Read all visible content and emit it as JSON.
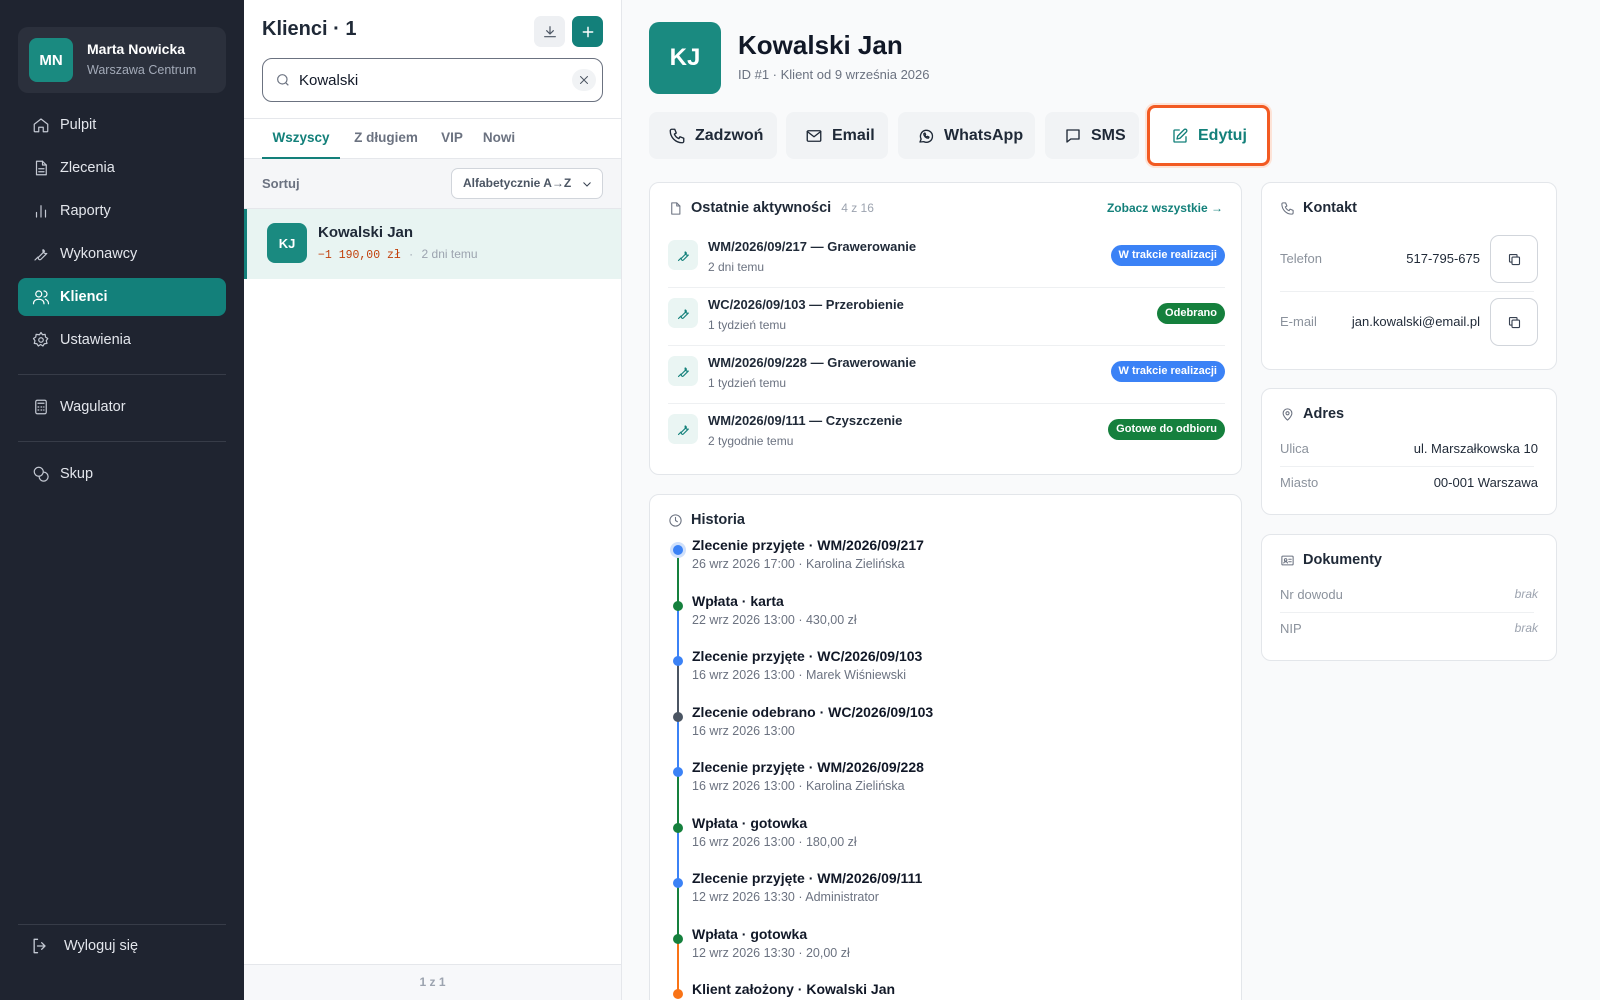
{
  "sidebar": {
    "user": {
      "initials": "MN",
      "name": "Marta Nowicka",
      "location": "Warszawa Centrum"
    },
    "nav": [
      {
        "label": "Pulpit",
        "icon": "home-icon"
      },
      {
        "label": "Zlecenia",
        "icon": "document-icon"
      },
      {
        "label": "Raporty",
        "icon": "bar-chart-icon"
      },
      {
        "label": "Wykonawcy",
        "icon": "wrench-icon"
      },
      {
        "label": "Klienci",
        "icon": "users-icon",
        "active": true
      },
      {
        "label": "Ustawienia",
        "icon": "gear-icon"
      }
    ],
    "extra": [
      {
        "label": "Wagulator",
        "icon": "calculator-icon"
      },
      {
        "label": "Skup",
        "icon": "coins-icon"
      }
    ],
    "logout_label": "Wyloguj się"
  },
  "list": {
    "title": "Klienci · 1",
    "search": {
      "value": "Kowalski",
      "placeholder": ""
    },
    "tabs": [
      "Wszyscy",
      "Z długiem",
      "VIP",
      "Nowi"
    ],
    "active_tab": "Wszyscy",
    "sort_label": "Sortuj",
    "sort_value": "Alfabetycznie A→Z",
    "clients": [
      {
        "initials": "KJ",
        "name": "Kowalski Jan",
        "debt": "−1 190,00 zł",
        "sep": "·",
        "last": "2 dni temu"
      }
    ],
    "pagination": "1 z 1"
  },
  "detail": {
    "initials": "KJ",
    "name": "Kowalski Jan",
    "subtitle": "ID #1 · Klient od 9 września 2026",
    "actions": {
      "call": "Zadzwoń",
      "email": "Email",
      "whatsapp": "WhatsApp",
      "sms": "SMS",
      "edit": "Edytuj"
    },
    "activities": {
      "title": "Ostatnie aktywności",
      "count": "4 z 16",
      "see_all": "Zobacz wszystkie →",
      "items": [
        {
          "title": "WM/2026/09/217 — Grawerowanie",
          "time": "2 dni temu",
          "status": "W trakcie realizacji",
          "status_color": "#3b82f6"
        },
        {
          "title": "WC/2026/09/103 — Przerobienie",
          "time": "1 tydzień temu",
          "status": "Odebrano",
          "status_color": "#15803d"
        },
        {
          "title": "WM/2026/09/228 — Grawerowanie",
          "time": "1 tydzień temu",
          "status": "W trakcie realizacji",
          "status_color": "#3b82f6"
        },
        {
          "title": "WM/2026/09/111 — Czyszczenie",
          "time": "2 tygodnie temu",
          "status": "Gotowe do odbioru",
          "status_color": "#15803d"
        }
      ]
    },
    "history": {
      "title": "Historia",
      "items": [
        {
          "title": "Zlecenie przyjęte · WM/2026/09/217",
          "sub": "26 wrz 2026 17:00 · Karolina Zielińska",
          "color": "#3b82f6"
        },
        {
          "title": "Wpłata · karta",
          "sub": "22 wrz 2026 13:00 · 430,00 zł",
          "color": "#15803d"
        },
        {
          "title": "Zlecenie przyjęte · WC/2026/09/103",
          "sub": "16 wrz 2026 13:00 · Marek Wiśniewski",
          "color": "#3b82f6"
        },
        {
          "title": "Zlecenie odebrano · WC/2026/09/103",
          "sub": "16 wrz 2026 13:00",
          "color": "#4b5563"
        },
        {
          "title": "Zlecenie przyjęte · WM/2026/09/228",
          "sub": "16 wrz 2026 13:00 · Karolina Zielińska",
          "color": "#3b82f6"
        },
        {
          "title": "Wpłata · gotowka",
          "sub": "16 wrz 2026 13:00 · 180,00 zł",
          "color": "#15803d"
        },
        {
          "title": "Zlecenie przyjęte · WM/2026/09/111",
          "sub": "12 wrz 2026 13:30 · Administrator",
          "color": "#3b82f6"
        },
        {
          "title": "Wpłata · gotowka",
          "sub": "12 wrz 2026 13:30 · 20,00 zł",
          "color": "#15803d"
        },
        {
          "title": "Klient założony · Kowalski Jan",
          "sub": "",
          "color": "#f97316"
        }
      ]
    },
    "contact": {
      "title": "Kontakt",
      "phone_label": "Telefon",
      "phone": "517-795-675",
      "email_label": "E-mail",
      "email": "jan.kowalski@email.pl"
    },
    "address": {
      "title": "Adres",
      "street_label": "Ulica",
      "street": "ul. Marszałkowska 10",
      "city_label": "Miasto",
      "city": "00-001 Warszawa"
    },
    "documents": {
      "title": "Dokumenty",
      "id_label": "Nr dowodu",
      "id_value": "brak",
      "nip_label": "NIP",
      "nip_value": "brak"
    }
  }
}
